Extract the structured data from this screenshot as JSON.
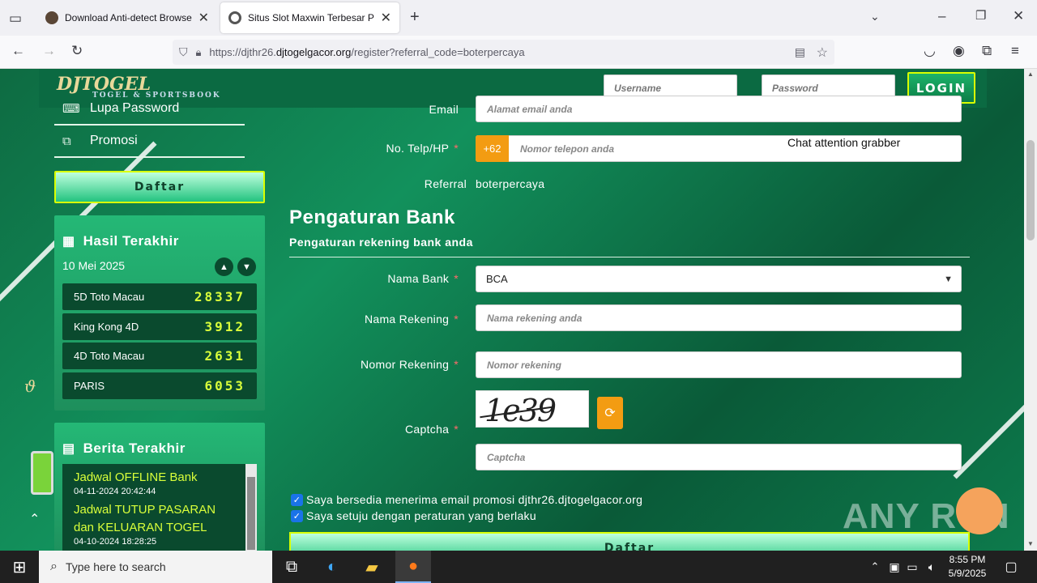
{
  "browser": {
    "tabs": [
      {
        "label": "Download Anti-detect Browser",
        "active": false
      },
      {
        "label": "Situs Slot Maxwin Terbesar Palin",
        "active": true
      }
    ],
    "url_prefix": "https://djthr26.",
    "url_host": "djtogelgacor.org",
    "url_path": "/register?referral_code=boterpercaya"
  },
  "header": {
    "logo_text": "DJTOGEL",
    "logo_sub": "TOGEL & SPORTSBOOK",
    "username_placeholder": "Username",
    "password_placeholder": "Password",
    "login_label": "LOGIN"
  },
  "sidebar": {
    "links": [
      {
        "label": "Lupa Password",
        "icon": "keyboard-icon"
      },
      {
        "label": "Promosi",
        "icon": "tags-icon"
      }
    ],
    "daftar_label": "Daftar",
    "results": {
      "title": "Hasil Terakhir",
      "date": "10 Mei 2025",
      "items": [
        {
          "name": "5D Toto Macau",
          "number": "28337"
        },
        {
          "name": "King Kong 4D",
          "number": "3912"
        },
        {
          "name": "4D Toto Macau",
          "number": "2631"
        },
        {
          "name": "PARIS",
          "number": "6053"
        }
      ]
    },
    "news": {
      "title": "Berita Terakhir",
      "items": [
        {
          "title": "Jadwal OFFLINE Bank",
          "date": "04-11-2024 20:42:44"
        },
        {
          "title": "Jadwal TUTUP PASARAN dan KELUARAN TOGEL",
          "date": "04-10-2024 18:28:25"
        }
      ]
    }
  },
  "form": {
    "email_label": "Email",
    "email_placeholder": "Alamat email anda",
    "phone_label": "No. Telp/HP",
    "phone_prefix": "+62",
    "phone_placeholder": "Nomor telepon anda",
    "referral_label": "Referral",
    "referral_value": "boterpercaya",
    "bank_section_title": "Pengaturan Bank",
    "bank_section_sub": "Pengaturan rekening bank anda",
    "bank_name_label": "Nama Bank",
    "bank_name_value": "BCA",
    "account_name_label": "Nama Rekening",
    "account_name_placeholder": "Nama rekening anda",
    "account_number_label": "Nomor Rekening",
    "account_number_placeholder": "Nomor rekening",
    "captcha_label": "Captcha",
    "captcha_text": "1e39",
    "captcha_placeholder": "Captcha",
    "check_promo": "Saya bersedia menerima email promosi djthr26.djtogelgacor.org",
    "check_terms": "Saya setuju dengan peraturan yang berlaku",
    "submit_label": "Daftar"
  },
  "overlay": {
    "chat_text": "Chat attention grabber",
    "watermark": "ANY RUN"
  },
  "taskbar": {
    "search_placeholder": "Type here to search",
    "time": "8:55 PM",
    "date": "5/9/2025"
  }
}
